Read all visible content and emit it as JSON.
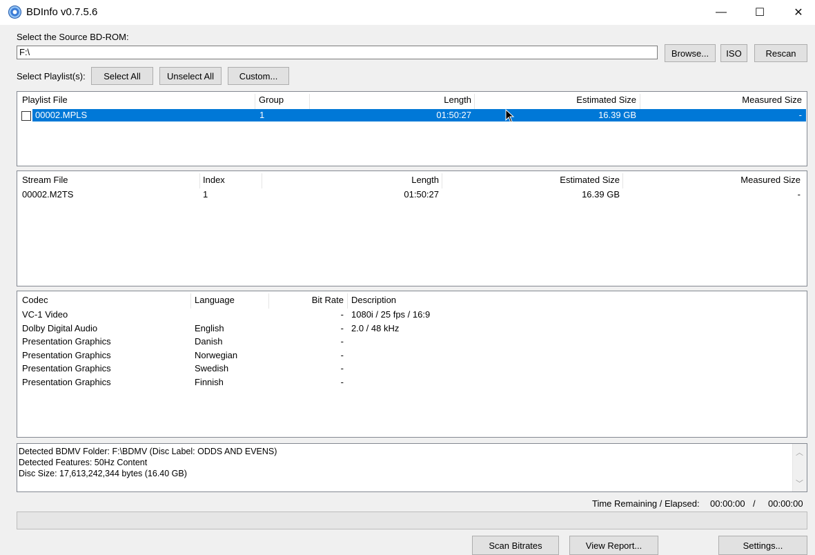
{
  "window": {
    "title": "BDInfo v0.7.5.6",
    "minimize_glyph": "—",
    "maximize_glyph": "☐",
    "close_glyph": "✕"
  },
  "source": {
    "label": "Select the Source BD-ROM:",
    "path_value": "F:\\",
    "browse_label": "Browse...",
    "iso_label": "ISO",
    "rescan_label": "Rescan"
  },
  "playlist_controls": {
    "label": "Select Playlist(s):",
    "select_all_label": "Select All",
    "unselect_all_label": "Unselect All",
    "custom_label": "Custom..."
  },
  "playlists": {
    "columns": [
      "Playlist File",
      "Group",
      "Length",
      "Estimated Size",
      "Measured Size"
    ],
    "rows": [
      {
        "file": "00002.MPLS",
        "group": "1",
        "length": "01:50:27",
        "estimated_size": "16.39 GB",
        "measured_size": "-",
        "checked": false,
        "selected": true
      }
    ]
  },
  "streams": {
    "columns": [
      "Stream File",
      "Index",
      "Length",
      "Estimated Size",
      "Measured Size"
    ],
    "rows": [
      {
        "file": "00002.M2TS",
        "index": "1",
        "length": "01:50:27",
        "estimated_size": "16.39 GB",
        "measured_size": "-"
      }
    ]
  },
  "codecs": {
    "columns": [
      "Codec",
      "Language",
      "Bit Rate",
      "Description"
    ],
    "rows": [
      {
        "codec": "VC-1 Video",
        "language": "",
        "bit_rate": "-",
        "description": "1080i / 25 fps / 16:9"
      },
      {
        "codec": "Dolby Digital Audio",
        "language": "English",
        "bit_rate": "-",
        "description": "2.0 / 48 kHz"
      },
      {
        "codec": "Presentation Graphics",
        "language": "Danish",
        "bit_rate": "-",
        "description": ""
      },
      {
        "codec": "Presentation Graphics",
        "language": "Norwegian",
        "bit_rate": "-",
        "description": ""
      },
      {
        "codec": "Presentation Graphics",
        "language": "Swedish",
        "bit_rate": "-",
        "description": ""
      },
      {
        "codec": "Presentation Graphics",
        "language": "Finnish",
        "bit_rate": "-",
        "description": ""
      }
    ]
  },
  "log": {
    "lines": [
      "Detected BDMV Folder: F:\\BDMV (Disc Label: ODDS AND EVENS)",
      "Detected Features: 50Hz Content",
      "Disc Size: 17,613,242,344 bytes (16.40 GB)"
    ]
  },
  "status": {
    "time_label": "Time Remaining / Elapsed:",
    "remaining": "00:00:00",
    "separator": "/",
    "elapsed": "00:00:00",
    "progress": 0
  },
  "bottom_buttons": {
    "scan_label": "Scan Bitrates",
    "report_label": "View Report...",
    "settings_label": "Settings..."
  },
  "colors": {
    "selection": "#0078d7",
    "window_bg": "#f0f0f0"
  }
}
